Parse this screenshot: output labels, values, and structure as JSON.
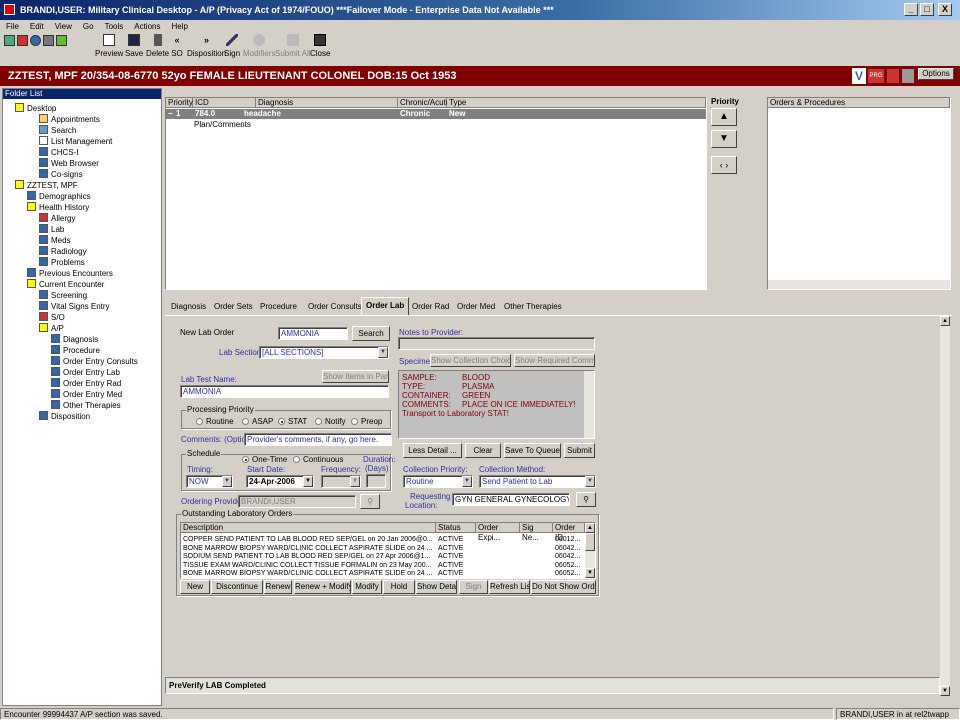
{
  "window": {
    "title": "BRANDI,USER: Military Clinical Desktop - A/P (Privacy Act of 1974/FOUO) ***Failover Mode - Enterprise Data Not Available ***",
    "min": "_",
    "max": "□",
    "close": "X"
  },
  "menu": [
    "File",
    "Edit",
    "View",
    "Go",
    "Tools",
    "Actions",
    "Help"
  ],
  "toolbar": {
    "preview": "Preview",
    "save": "Save",
    "delete": "Delete",
    "so": "SO",
    "disposition": "Disposition",
    "sign": "Sign",
    "modifiers": "Modifiers",
    "submit_all": "Submit All",
    "close": "Close"
  },
  "patient": {
    "banner": "ZZTEST, MPF   20/354-08-6770  52yo  FEMALE  LIEUTENANT COLONEL  DOB:15 Oct 1953",
    "options": "Options"
  },
  "folder": {
    "title": "Folder List",
    "items": [
      "Desktop",
      "Appointments",
      "Search",
      "List Management",
      "CHCS-I",
      "Web Browser",
      "Co-signs",
      "ZZTEST, MPF",
      "Demographics",
      "Health History",
      "Allergy",
      "Lab",
      "Meds",
      "Radiology",
      "Problems",
      "Previous Encounters",
      "Current Encounter",
      "Screening",
      "Vital Signs Entry",
      "S/O",
      "A/P",
      "Diagnosis",
      "Procedure",
      "Order Entry Consults",
      "Order Entry Lab",
      "Order Entry Rad",
      "Order Entry Med",
      "Other Therapies",
      "Disposition"
    ]
  },
  "diag": {
    "headers": [
      "Priority",
      "ICD",
      "Diagnosis",
      "Chronic/Acute",
      "Type"
    ],
    "row": {
      "priority": "1",
      "icd": "784.0",
      "diagnosis": "headache",
      "chronic": "Chronic",
      "type": "New"
    },
    "sub": "Plan/Comments",
    "priority_label": "Priority",
    "orders_header": "Orders & Procedures"
  },
  "tabs": [
    "Diagnosis",
    "Order Sets",
    "Procedure",
    "Order Consults",
    "Order Lab",
    "Order Rad",
    "Order Med",
    "Other Therapies"
  ],
  "lab": {
    "new_lab_order": "New Lab Order",
    "search_value": "AMMONIA",
    "search_btn": "Search",
    "lab_section_label": "Lab Section:",
    "lab_section": "[ALL SECTIONS]",
    "show_items": "Show Items in Panel",
    "lab_test_label": "Lab Test Name:",
    "lab_test": "AMMONIA",
    "processing_priority": "Processing Priority",
    "priorities": [
      "Routine",
      "ASAP",
      "STAT",
      "Notify",
      "Preop"
    ],
    "comments_label": "Comments: (Optional)",
    "comments": "Provider's comments, if any, go here.",
    "schedule": "Schedule",
    "one_time": "One-Time",
    "continuous": "Continuous",
    "timing_label": "Timing:",
    "timing": "NOW",
    "start_label": "Start Date:",
    "start": "24-Apr-2006",
    "frequency_label": "Frequency:",
    "duration_label": "Duration:",
    "duration_unit": "(Days)",
    "ordering_label": "Ordering Provider:",
    "ordering": "BRANDI,USER",
    "notes_label": "Notes to Provider:",
    "specimen_label": "Specimen:",
    "show_collection": "Show Collection Choices",
    "show_required": "Show Required Comments",
    "specimen_lines": [
      [
        "SAMPLE:",
        "BLOOD"
      ],
      [
        "TYPE:",
        "PLASMA"
      ],
      [
        "CONTAINER:",
        "GREEN"
      ],
      [
        "COMMENTS:",
        "PLACE ON ICE IMMEDIATELY!"
      ]
    ],
    "specimen_extra": "Transport to Laboratory STAT!",
    "less_detail": "Less Detail ...",
    "clear": "Clear",
    "save_queue": "Save To Queue",
    "submit": "Submit",
    "collection_priority_label": "Collection Priority:",
    "collection_priority": "Routine",
    "collection_method_label": "Collection Method:",
    "collection_method": "Send Patient to Lab",
    "requesting_label_1": "Requesting",
    "requesting_label_2": "Location:",
    "requesting": "GYN GENERAL GYNECOLOGY"
  },
  "outstanding": {
    "title": "Outstanding Laboratory Orders",
    "headers": [
      "Description",
      "Status",
      "Order Expi...",
      "Sig Ne...",
      "Order ID"
    ],
    "rows": [
      [
        "COPPER  SEND PATIENT TO LAB  BLOOD  RED SEP/GEL  on 20 Jan 2006@0...",
        "ACTIVE",
        "",
        "",
        "06012..."
      ],
      [
        "BONE MARROW BIOPSY  WARD/CLINIC COLLECT  ASPIRATE  SLIDE  on 24 ...",
        "ACTIVE",
        "",
        "",
        "06042..."
      ],
      [
        "SODIUM  SEND PATIENT TO LAB  BLOOD  RED SEP/GEL  on 27 Apr 2006@1...",
        "ACTIVE",
        "",
        "",
        "06042..."
      ],
      [
        "TISSUE EXAM  WARD/CLINIC COLLECT  TISSUE  FORMALIN  on 23 May 200...",
        "ACTIVE",
        "",
        "",
        "06052..."
      ],
      [
        "BONE MARROW BIOPSY  WARD/CLINIC COLLECT  ASPIRATE  SLIDE  on 24 ...",
        "ACTIVE",
        "",
        "",
        "06052..."
      ]
    ],
    "buttons": [
      "New",
      "Discontinue",
      "Renew",
      "Renew + Modify",
      "Modify",
      "Hold",
      "Show Detail",
      "Sign",
      "Refresh List",
      "Do Not Show Orders"
    ]
  },
  "preverify": "PreVerify LAB Completed",
  "status": {
    "left": "Encounter 99994437 A/P section was saved.",
    "right": "BRANDI,USER in  at rel2twapp 746.0t"
  }
}
